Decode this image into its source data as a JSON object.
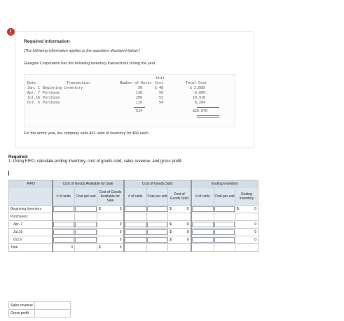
{
  "alert_icon": "alert-icon",
  "info": {
    "title": "Required information",
    "note": "[The following information applies to the questions displayed below.]",
    "intro": "Glasgow Corporation has the following inventory transactions during the year.",
    "headers": {
      "date": "Date",
      "transaction": "Transaction",
      "units": "Number of Units",
      "unit_top": "Unit",
      "cost": "Cost",
      "total": "Total Cost"
    },
    "rows": [
      {
        "date": "Jan. 1",
        "transaction": "Beginning inventory",
        "units": "56",
        "cost": "$ 48",
        "total": "$ 2,688"
      },
      {
        "date": "Apr. 7",
        "transaction": "Purchase",
        "units": "136",
        "cost": "50",
        "total": "6,800"
      },
      {
        "date": "Jul.16",
        "transaction": "Purchase",
        "units": "206",
        "cost": "53",
        "total": "10,918"
      },
      {
        "date": "Oct. 6",
        "transaction": "Purchase",
        "units": "116",
        "cost": "54",
        "total": "6,264"
      }
    ],
    "total_units": "514",
    "total_cost": "$26,670",
    "sells_text": "For the entire year, the company sells 442 units of inventory for $66 each."
  },
  "required": {
    "heading": "Required:",
    "item": "1. Using FIFO, calculate ending inventory, cost of goods sold, sales revenue, and gross profit."
  },
  "grid": {
    "method": "FIFO",
    "groups": {
      "available": "Cost of Goods Available for Sale",
      "sold": "Cost of Goods Sold",
      "ending": "Ending Inventory"
    },
    "cols": {
      "units": "# of units",
      "cost_per_unit": "Cost per unit",
      "cogs_available": "Cost of Goods Available for Sale",
      "sold_units": "# of units",
      "sold_cost": "Cost per unit",
      "cogs_sold": "Cost of Goods Sold",
      "end_units": "# of units",
      "end_cost": "Cost per unit",
      "end_inventory": "Ending Inventory"
    },
    "rows": {
      "beginning": {
        "label": "Beginning Inventory",
        "avail_dollar": "$",
        "avail_value": "0",
        "sold_dollar": "$",
        "sold_value": "0",
        "sold_dollar2": "$",
        "end_value": "0"
      },
      "purchases": {
        "label": "Purchases:"
      },
      "apr": {
        "label": "Apr. 7",
        "avail_value": "0",
        "sold_dollar": "$",
        "sold_value": "0",
        "end_value": "0"
      },
      "jul": {
        "label": "Jul.16",
        "avail_value": "0",
        "sold_dollar": "$",
        "sold_value": "0",
        "end_value": "0"
      },
      "oct": {
        "label": "Oct.6",
        "avail_value": "0",
        "sold_dollar": "$",
        "sold_value": "0",
        "end_value": "0"
      },
      "total": {
        "label": "Total",
        "units_value": "0",
        "avail_dollar": "$",
        "avail_value": "0"
      }
    }
  },
  "summary": {
    "sales_revenue": "Sales revenue",
    "gross_profit": "Gross profit"
  }
}
